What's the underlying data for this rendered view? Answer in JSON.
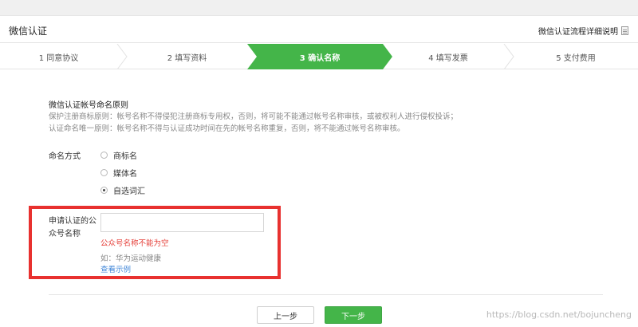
{
  "header": {
    "title": "微信认证",
    "help_link": "微信认证流程详细说明",
    "help_icon": "document-icon"
  },
  "steps": [
    {
      "label": "1 同意协议",
      "active": false
    },
    {
      "label": "2 填写资料",
      "active": false
    },
    {
      "label": "3 确认名称",
      "active": true
    },
    {
      "label": "4 填写发票",
      "active": false
    },
    {
      "label": "5 支付费用",
      "active": false
    }
  ],
  "colors": {
    "active_step": "#44b549",
    "error": "#e5403a",
    "link": "#3f86d8",
    "highlight_border": "#e8312f"
  },
  "rules": {
    "title": "微信认证帐号命名原则",
    "line1": "保护注册商标原则：帐号名称不得侵犯注册商标专用权，否则，将可能不能通过帐号名称审核，或被权利人进行侵权投诉；",
    "line2": "认证命名唯一原则：帐号名称不得与认证成功时间在先的帐号名称重复，否则，将不能通过帐号名称审核。"
  },
  "naming": {
    "label": "命名方式",
    "options": [
      {
        "label": "商标名",
        "checked": false
      },
      {
        "label": "媒体名",
        "checked": false
      },
      {
        "label": "自选词汇",
        "checked": true
      }
    ]
  },
  "field": {
    "label": "申请认证的公众号名称",
    "value": "",
    "placeholder": "",
    "error": "公众号名称不能为空",
    "hint": "如：华为运动健康",
    "example_link": "查看示例"
  },
  "buttons": {
    "prev": "上一步",
    "next": "下一步"
  },
  "watermark": "https://blog.csdn.net/bojuncheng"
}
